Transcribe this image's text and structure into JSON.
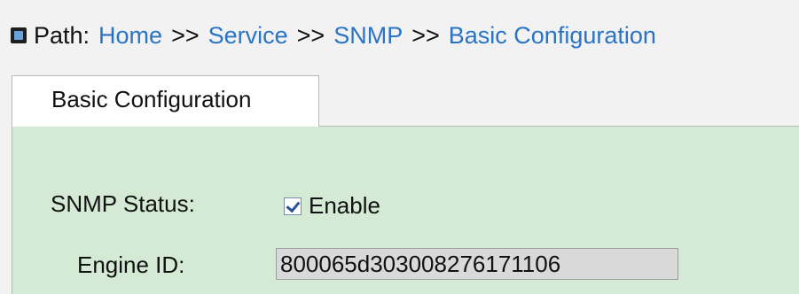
{
  "breadcrumb": {
    "label": "Path:",
    "separator": ">>",
    "items": [
      "Home",
      "Service",
      "SNMP",
      "Basic Configuration"
    ]
  },
  "tabs": [
    {
      "label": "Basic Configuration",
      "active": true
    }
  ],
  "form": {
    "snmp_status": {
      "label": "SNMP Status:",
      "checkbox_label": "Enable",
      "checked": true
    },
    "engine_id": {
      "label": "Engine ID:",
      "value": "800065d303008276171106",
      "readonly": true
    }
  },
  "colors": {
    "link": "#2a74c6",
    "panel_bg": "#d4ead4",
    "page_bg": "#f2f2f2",
    "input_bg": "#d9d9d9"
  }
}
